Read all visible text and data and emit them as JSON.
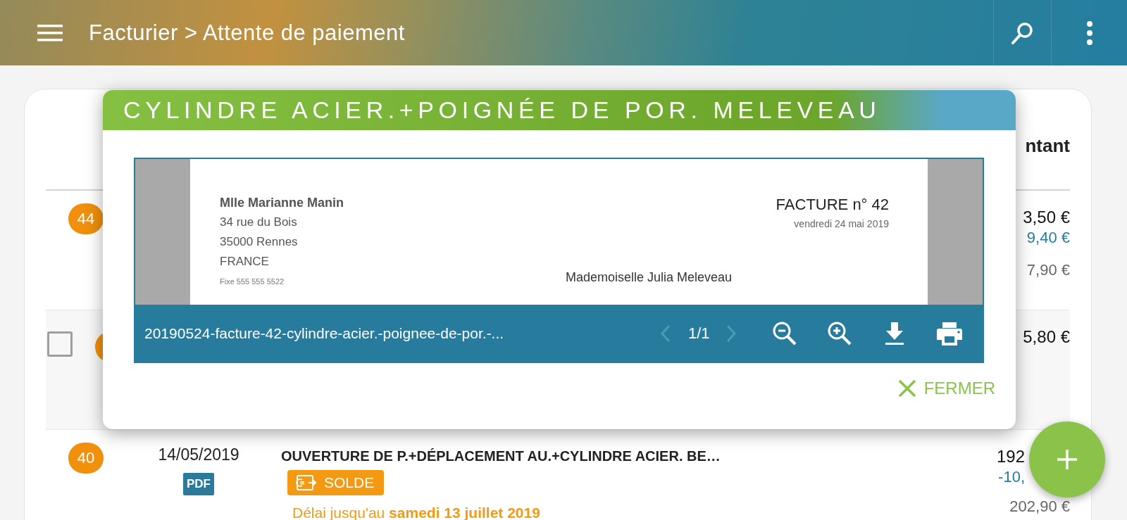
{
  "app_bar": {
    "title": "Facturier > Attente de paiement"
  },
  "table": {
    "header_partial": "ntant",
    "rows": [
      {
        "badge": {
          "text": "44"
        },
        "amounts": [
          {
            "text": "3,50 €",
            "kind": "total"
          },
          {
            "text": "9,40 €",
            "kind": "paid"
          },
          {
            "text": "7,90 €",
            "kind": "remaining"
          }
        ]
      },
      {
        "checkbox": {
          "checked": false
        },
        "badge": {},
        "amounts": [
          {
            "text": "5,80 €",
            "kind": "total"
          }
        ]
      },
      {
        "badge": {
          "text": "40"
        },
        "date": "14/05/2019",
        "attachment": "PDF",
        "title": "OUVERTURE DE P.+DÉPLACEMENT AU.+CYLINDRE ACIER. BE…",
        "status": "SOLDE",
        "deadline": "Délai jusqu'au **samedi 13 juillet 2019**",
        "amounts": [
          {
            "text": "192",
            "kind": "total"
          },
          {
            "text": "-10,",
            "kind": "paid"
          },
          {
            "text": "202,90 €",
            "kind": "remaining"
          }
        ]
      }
    ]
  },
  "dialog": {
    "title": "CYLINDRE ACIER.+POIGNÉE DE POR. MELEVEAU",
    "document": {
      "sender": [
        "Mlle Marianne Manin",
        "34 rue du Bois",
        "35000 Rennes",
        "FRANCE",
        "Fixe 555 555 5522"
      ],
      "invoice_title": "FACTURE n° 42",
      "invoice_date": "vendredi 24 mai 2019",
      "recipient": "Mademoiselle Julia Meleveau"
    },
    "toolbar": {
      "filename": "20190524-facture-42-cylindre-acier.-poignee-de-por.-...",
      "prev": {
        "disabled": true
      },
      "page": "1/1",
      "next": {
        "disabled": true
      }
    },
    "close_button": "FERMER"
  }
}
